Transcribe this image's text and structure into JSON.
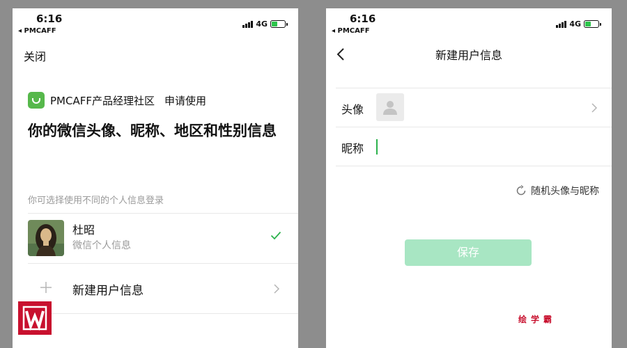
{
  "left_screen": {
    "status": {
      "time": "6:16",
      "carrier": "◂ PMCAFF",
      "network": "4G"
    },
    "close_label": "关闭",
    "app": {
      "name": "PMCAFF产品经理社区",
      "action": "申请使用"
    },
    "title": "你的微信头像、昵称、地区和性别信息",
    "hint": "你可选择使用不同的个人信息登录",
    "profile": {
      "name": "杜昭",
      "subtitle": "微信个人信息"
    },
    "new_profile_label": "新建用户信息"
  },
  "right_screen": {
    "status": {
      "time": "6:16",
      "carrier": "◂ PMCAFF",
      "network": "4G"
    },
    "title": "新建用户信息",
    "avatar_label": "头像",
    "nickname_label": "昵称",
    "nickname_value": "",
    "random_label": "随机头像与昵称",
    "save_label": "保存"
  },
  "watermark": "绘学霸",
  "colors": {
    "accent": "#2bb24c",
    "save_disabled": "#a8e6c3",
    "brand_logo": "#c8102e",
    "app_logo": "#56b84b"
  },
  "icons": [
    "signal-icon",
    "battery-icon",
    "app-logo-icon",
    "checkmark-icon",
    "plus-icon",
    "chevron-right-icon",
    "back-arrow-icon",
    "default-avatar-icon",
    "refresh-icon",
    "w-logo"
  ]
}
